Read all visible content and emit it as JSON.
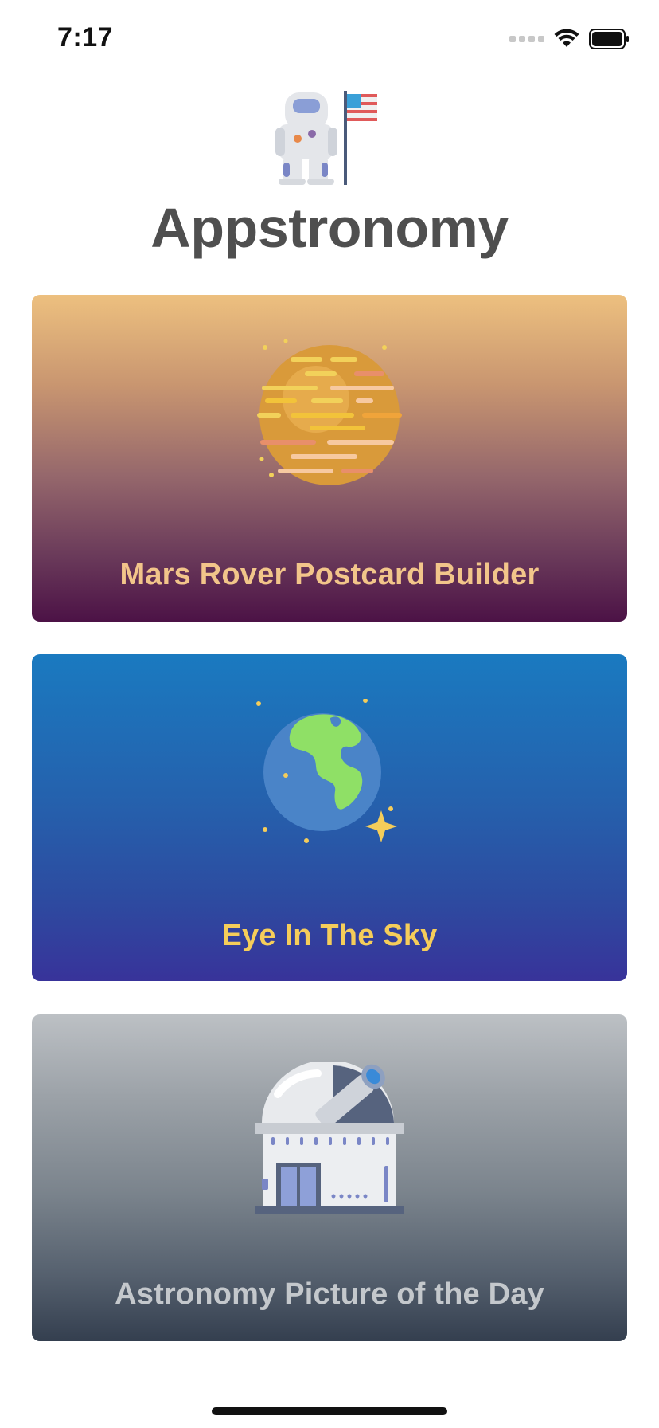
{
  "status_bar": {
    "time": "7:17"
  },
  "header": {
    "title": "Appstronomy",
    "logo_icon": "astronaut-with-flag-icon"
  },
  "cards": [
    {
      "label": "Mars Rover Postcard Builder",
      "icon": "mars-planet-icon",
      "label_color": "#f2c58a"
    },
    {
      "label": "Eye In The Sky",
      "icon": "earth-globe-icon",
      "label_color": "#f5cd5a"
    },
    {
      "label": "Astronomy Picture of the Day",
      "icon": "observatory-icon",
      "label_color": "#c4c8cc"
    }
  ]
}
